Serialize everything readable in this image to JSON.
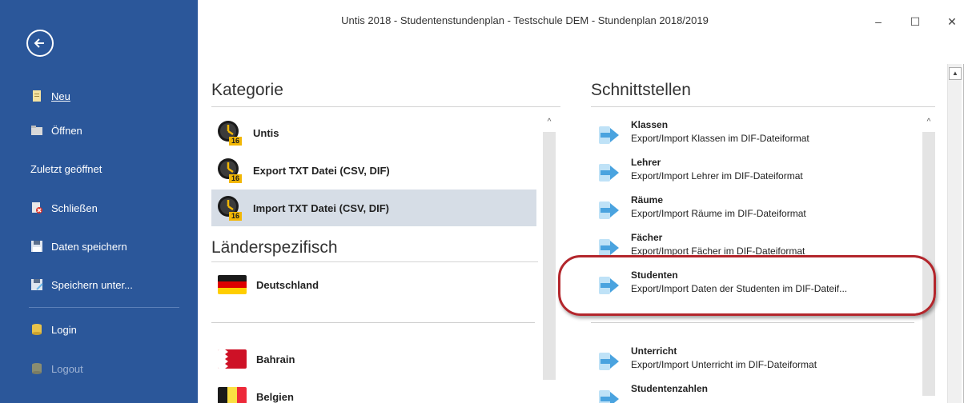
{
  "window": {
    "title": "Untis 2018 - Studentenstundenplan  - Testschule DEM  - Stundenplan 2018/2019",
    "minimize": "–",
    "maximize": "☐",
    "close": "✕"
  },
  "sidebar": {
    "back_icon": "arrow-left-circle-icon",
    "items": [
      {
        "label": "Neu",
        "icon": "new-document-icon"
      },
      {
        "label": "Öffnen",
        "icon": "open-folder-icon"
      },
      {
        "label": "Zuletzt geöffnet"
      },
      {
        "label": "Schließen",
        "icon": "close-document-icon"
      },
      {
        "label": "Daten speichern",
        "icon": "save-icon"
      },
      {
        "label": "Speichern unter...",
        "icon": "save-as-icon"
      },
      {
        "label": "Login",
        "icon": "database-icon"
      },
      {
        "label": "Logout",
        "icon": "database-icon",
        "disabled": true
      }
    ],
    "colors": {
      "background": "#2b579a",
      "disabled_text": "#9fb3d4"
    }
  },
  "kategorie": {
    "heading": "Kategorie",
    "items": [
      {
        "label": "Untis",
        "icon": "untis-clock-icon",
        "badge": "16"
      },
      {
        "label": "Export TXT Datei (CSV, DIF)",
        "icon": "untis-clock-icon",
        "badge": "16"
      },
      {
        "label": "Import TXT Datei (CSV, DIF)",
        "icon": "untis-clock-icon",
        "badge": "16",
        "selected": true
      }
    ],
    "laender_heading": "Länderspezifisch",
    "countries": [
      {
        "label": "Deutschland",
        "icon": "flag-germany-icon"
      },
      {
        "label": "Bahrain",
        "icon": "flag-bahrain-icon"
      },
      {
        "label": "Belgien",
        "icon": "flag-belgium-icon"
      }
    ]
  },
  "schnittstellen": {
    "heading": "Schnittstellen",
    "items": [
      {
        "title": "Klassen",
        "desc": "Export/Import Klassen im DIF-Dateiformat",
        "icon": "import-arrow-icon"
      },
      {
        "title": "Lehrer",
        "desc": "Export/Import Lehrer im DIF-Dateiformat",
        "icon": "import-arrow-icon"
      },
      {
        "title": "Räume",
        "desc": "Export/Import Räume im DIF-Dateiformat",
        "icon": "import-arrow-icon"
      },
      {
        "title": "Fächer",
        "desc": "Export/Import Fächer im DIF-Dateiformat",
        "icon": "import-arrow-icon"
      },
      {
        "title": "Studenten",
        "desc": "Export/Import Daten der Studenten im DIF-Dateif...",
        "icon": "import-arrow-icon",
        "highlighted": true
      },
      {
        "title": "Unterricht",
        "desc": "Export/Import Unterricht im DIF-Dateiformat",
        "icon": "import-arrow-icon"
      },
      {
        "title": "Studentenzahlen",
        "desc": "",
        "icon": "import-arrow-icon"
      }
    ],
    "colors": {
      "arrow": "#4aa3df",
      "highlight_ring": "#b3262c"
    }
  }
}
